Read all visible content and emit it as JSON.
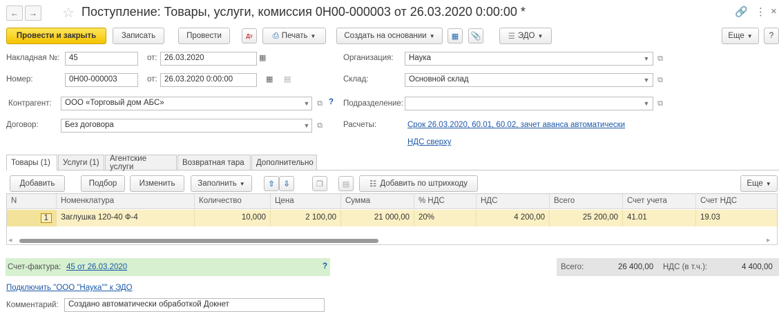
{
  "header": {
    "title": "Поступление: Товары, услуги, комиссия 0Н00-000003 от 26.03.2020 0:00:00 *",
    "back_icon": "arrow-left-icon",
    "forward_icon": "arrow-right-icon",
    "favorite_icon": "star-icon",
    "more_icon": "kebab-icon"
  },
  "toolbar": {
    "post_close": "Провести и закрыть",
    "write": "Записать",
    "post": "Провести",
    "print": "Печать",
    "create_based_on": "Создать на основании",
    "edo": "ЭДО",
    "more": "Еще",
    "help": "?"
  },
  "form": {
    "invoice_label": "Накладная №:",
    "invoice_value": "45",
    "from_label": "от:",
    "invoice_date": "26.03.2020",
    "number_label": "Номер:",
    "number_value": "0Н00-000003",
    "number_date": "26.03.2020  0:00:00",
    "counterparty_label": "Контрагент:",
    "counterparty_value": "ООО «Торговый дом АБС»",
    "contract_label": "Договор:",
    "contract_value": "Без договора",
    "organization_label": "Организация:",
    "organization_value": "Наука",
    "warehouse_label": "Склад:",
    "warehouse_value": "Основной склад",
    "subdivision_label": "Подразделение:",
    "subdivision_value": "",
    "settlements_label": "Расчеты:",
    "settlements_link": "Срок 26.03.2020, 60.01, 60.02, зачет аванса автоматически",
    "vat_link": "НДС сверху",
    "help_q": "?"
  },
  "tabs": [
    {
      "label": "Товары (1)"
    },
    {
      "label": "Услуги (1)"
    },
    {
      "label": "Агентские услуги"
    },
    {
      "label": "Возвратная тара"
    },
    {
      "label": "Дополнительно"
    }
  ],
  "table_toolbar": {
    "add": "Добавить",
    "pick": "Подбор",
    "change": "Изменить",
    "fill": "Заполнить",
    "add_barcode": "Добавить по штрихкоду",
    "more": "Еще"
  },
  "table": {
    "columns": [
      "N",
      "Номенклатура",
      "Количество",
      "Цена",
      "Сумма",
      "% НДС",
      "НДС",
      "Всего",
      "Счет учета",
      "Счет НДС"
    ],
    "rows": [
      [
        "1",
        "Заглушка 120-40 Ф-4",
        "10,000",
        "2 100,00",
        "21 000,00",
        "20%",
        "4 200,00",
        "25 200,00",
        "41.01",
        "19.03"
      ]
    ]
  },
  "footer": {
    "invoice_label": "Счет-фактура:",
    "invoice_link": "45 от 26.03.2020",
    "help_q": "?",
    "total_label": "Всего:",
    "total_value": "26 400,00",
    "vat_incl_label": "НДС (в т.ч.):",
    "vat_incl_value": "4 400,00",
    "connect_edo": "Подключить \"ООО \"Наука\"\" к ЭДО",
    "comment_label": "Комментарий:",
    "comment_value": "Создано автоматически обработкой Докнет"
  },
  "colors": {
    "primary_button": "#f5c400",
    "selected_row": "#fbf0c4",
    "link": "#1c58a8",
    "invoice_bar": "#d6f0d0",
    "total_bar": "#e4e4e4"
  }
}
